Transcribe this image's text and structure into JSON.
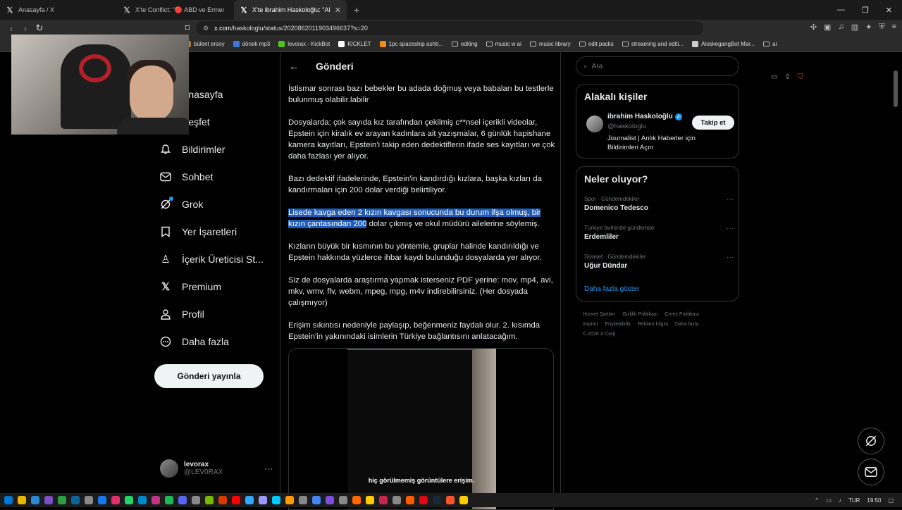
{
  "browser": {
    "tabs": [
      {
        "label": "Anasayfa / X"
      },
      {
        "label": "X'te Conflict: \"🔴 ABD ve Ermenistan"
      },
      {
        "label": "X'te ibrahim Haskoloğlu: \"ABD A"
      }
    ],
    "url_host": "x.com",
    "url_path": "/haskologlu/status/2020862011903496637?s=20",
    "bookmarks": [
      {
        "label": "bülent ersoy",
        "color": "#b07a3a"
      },
      {
        "label": "dönek mp3",
        "color": "#3a7bd5"
      },
      {
        "label": "levorax - KickBot",
        "color": "#53c41a"
      },
      {
        "label": "KİCKLET",
        "color": "#ffffff"
      },
      {
        "label": "1pc spaceship ashtr...",
        "color": "#f28c1b"
      },
      {
        "label": "editing",
        "color": ""
      },
      {
        "label": "music w ai",
        "color": ""
      },
      {
        "label": "music library",
        "color": ""
      },
      {
        "label": "edit packs",
        "color": ""
      },
      {
        "label": "streaming and editi...",
        "color": ""
      },
      {
        "label": "AloskegangBot Mar...",
        "color": "#cccccc"
      },
      {
        "label": "ai",
        "color": ""
      }
    ]
  },
  "nav": {
    "items": [
      {
        "label": "Anasayfa",
        "icon": "home-icon"
      },
      {
        "label": "Keşfet",
        "icon": "search-icon"
      },
      {
        "label": "Bildirimler",
        "icon": "bell-icon"
      },
      {
        "label": "Sohbet",
        "icon": "mail-icon"
      },
      {
        "label": "Grok",
        "icon": "grok-icon"
      },
      {
        "label": "Yer İşaretleri",
        "icon": "bookmark-icon"
      },
      {
        "label": "İçerik Üreticisi St...",
        "icon": "creator-icon"
      },
      {
        "label": "Premium",
        "icon": "x-logo-icon"
      },
      {
        "label": "Profil",
        "icon": "profile-icon"
      },
      {
        "label": "Daha fazla",
        "icon": "more-icon"
      }
    ],
    "post_button": "Gönderi yayınla",
    "account": {
      "name": "levorax",
      "handle": "@LEV0RAX"
    }
  },
  "post": {
    "header_title": "Gönderi",
    "paragraphs": [
      "İstismar sonrası bazı bebekler bu adada doğmuş veya babaları bu testlerle bulunmuş olabilir.labilir",
      "Dosyalarda; çok sayıda kız tarafından çekilmiş c**nsel içerikli videolar, Epstein için kiralık ev arayan kadınlara ait yazışmalar, 6 günlük hapishane kamera kayıtları, Epstein'i takip eden dedektiflerin ifade ses kayıtları ve çok daha fazlası yer alıyor.",
      "Bazı dedektif ifadelerinde, Epstein'in kandırdığı kızlara, başka kızları da kandırmaları için 200 dolar verdiği belirtiliyor."
    ],
    "highlighted_part": "Lisede kavga eden 2 kızın kavgası sonucunda bu durum ifşa olmuş, bir kızın çantasından 200",
    "highlighted_rest": " dolar çıkmış ve okul müdürü ailelerine söylemiş.",
    "paragraphs_after": [
      "Kızların büyük bir kısmının bu yöntemle, gruplar halinde kandırıldığı ve Epstein hakkında yüzlerce ihbar kaydı bulunduğu dosyalarda yer alıyor.",
      "Siz de dosyalarda araştırma yapmak isterseniz PDF yerine: mov, mp4, avi, mkv, wmv, flv, webm, mpeg, mpg, m4v indirebilirsiniz. (Her dosyada çalışmıyor)",
      "Erişim sıkıntısı nedeniyle paylaşıp, beğenmeniz faydalı olur. 2. kısımda Epstein'in yakınındaki isimlerin Türkiye bağlantısını anlatacağım."
    ],
    "video_caption": "hiç görülmemiş görüntülere erişim."
  },
  "sidebar": {
    "search_placeholder": "Ara",
    "related_title": "Alakalı kişiler",
    "person": {
      "name": "ibrahim Haskoloğlu",
      "handle": "@haskologlu",
      "bio": "Journalist | Anlık Haberler için Bildirimleri Açın",
      "follow_label": "Takip et"
    },
    "trends_title": "Neler oluyor?",
    "trends": [
      {
        "category": "Spor · Gündemdekiler",
        "name": "Domenico Tedesco"
      },
      {
        "category": "Türkiye tarihinde gündemde",
        "name": "Erdemliler"
      },
      {
        "category": "Siyaset · Gündemdekiler",
        "name": "Uğur Dündar"
      }
    ],
    "show_more": "Daha fazla göster",
    "footer": [
      "Hizmet Şartları",
      "Gizlilik Politikası",
      "Çerez Politikası",
      "Imprint",
      "Erişilebilirlik",
      "Reklam bilgisi",
      "Daha fazla ...",
      "© 2026 X Corp."
    ]
  },
  "taskbar": {
    "lang": "TUR",
    "time": "19:50"
  },
  "colors": {
    "accent": "#1d9bf0",
    "highlight": "#1f5cb8",
    "border": "#2f3336"
  }
}
